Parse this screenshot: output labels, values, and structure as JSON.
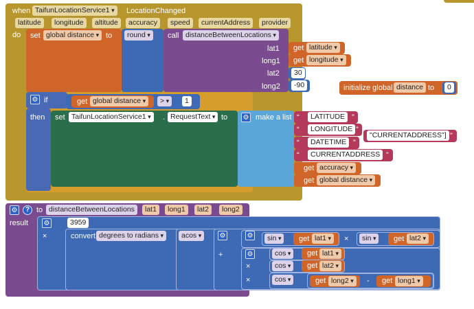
{
  "colors": {
    "event": "#b8962e",
    "variable": "#d0652a",
    "math": "#3e69b5",
    "procedure": "#7a4b8f",
    "control": "#4a69b5",
    "component": "#2b6e4c",
    "list": "#5aa6d8",
    "text": "#b5395a"
  },
  "event": {
    "when": "when",
    "component": "TaifunLocationService1",
    "event_name": "LocationChanged",
    "params": [
      "latitude",
      "longitude",
      "altitude",
      "accuracy",
      "speed",
      "currentAddress",
      "provider"
    ],
    "do": "do"
  },
  "set1": {
    "set": "set",
    "var": "global distance",
    "to": "to",
    "round": "round",
    "call": "call",
    "proc": "distanceBetweenLocations",
    "args": [
      {
        "label": "lat1",
        "get": "get",
        "value": "latitude",
        "type": "get"
      },
      {
        "label": "long1",
        "get": "get",
        "value": "longitude",
        "type": "get"
      },
      {
        "label": "lat2",
        "value": "30",
        "type": "num"
      },
      {
        "label": "long2",
        "value": "-90",
        "type": "num"
      }
    ]
  },
  "init": {
    "label": "initialize global",
    "var": "distance",
    "to": "to",
    "value": "0"
  },
  "if_block": {
    "if": "if",
    "get": "get",
    "var": "global distance",
    "op": ">",
    "num": "1",
    "then": "then"
  },
  "set2": {
    "set": "set",
    "component": "TaifunLocationService1",
    "dot": ".",
    "prop": "RequestText",
    "to": "to",
    "make_list": "make a list",
    "items": [
      {
        "type": "text",
        "value": "LATITUDE"
      },
      {
        "type": "text",
        "value": "LONGITUDE"
      },
      {
        "type": "text",
        "value": "DATETIME"
      },
      {
        "type": "text",
        "value": "CURRENTADDRESS"
      },
      {
        "type": "get",
        "get": "get",
        "value": "accuracy"
      },
      {
        "type": "get",
        "get": "get",
        "value": "global distance"
      }
    ],
    "floating_text": "\"CURRENTADDRESS\"]"
  },
  "proc": {
    "to": "to",
    "name": "distanceBetweenLocations",
    "params": [
      "lat1",
      "long1",
      "lat2",
      "long2"
    ],
    "result": "result",
    "num": "3959",
    "times": "×",
    "plus": "+",
    "convert": "convert",
    "mode": "degrees to radians",
    "acos": "acos",
    "sin": "sin",
    "cos": "cos",
    "get": "get",
    "lat1": "lat1",
    "lat2": "lat2",
    "long1": "long1",
    "long2": "long2",
    "minus": "-"
  }
}
